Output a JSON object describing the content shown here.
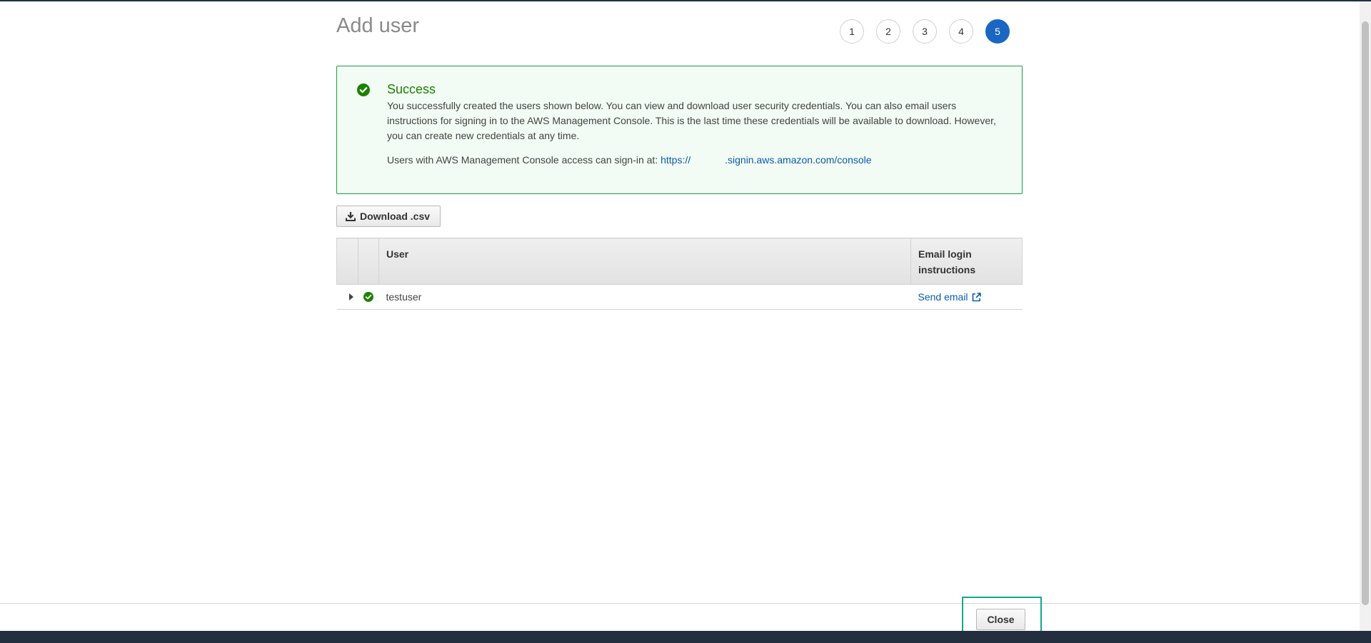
{
  "page": {
    "title": "Add user"
  },
  "steps": [
    {
      "label": "1",
      "active": false
    },
    {
      "label": "2",
      "active": false
    },
    {
      "label": "3",
      "active": false
    },
    {
      "label": "4",
      "active": false
    },
    {
      "label": "5",
      "active": true
    }
  ],
  "success": {
    "title": "Success",
    "body": "You successfully created the users shown below. You can view and download user security credentials. You can also email users instructions for signing in to the AWS Management Console. This is the last time these credentials will be available to download. However, you can create new credentials at any time.",
    "signin_prefix": "Users with AWS Management Console access can sign-in at:",
    "signin_link_start": "https://",
    "signin_link_end": ".signin.aws.amazon.com/console"
  },
  "toolbar": {
    "download_label": "Download .csv"
  },
  "table": {
    "headers": {
      "user": "User",
      "email": "Email login instructions"
    },
    "rows": [
      {
        "user": "testuser",
        "email_link": "Send email"
      }
    ]
  },
  "footer": {
    "close_label": "Close"
  },
  "colors": {
    "accent": "#1a66c2",
    "success": "#1d8102",
    "link": "#0b5cad",
    "highlight": "#13a88b"
  }
}
